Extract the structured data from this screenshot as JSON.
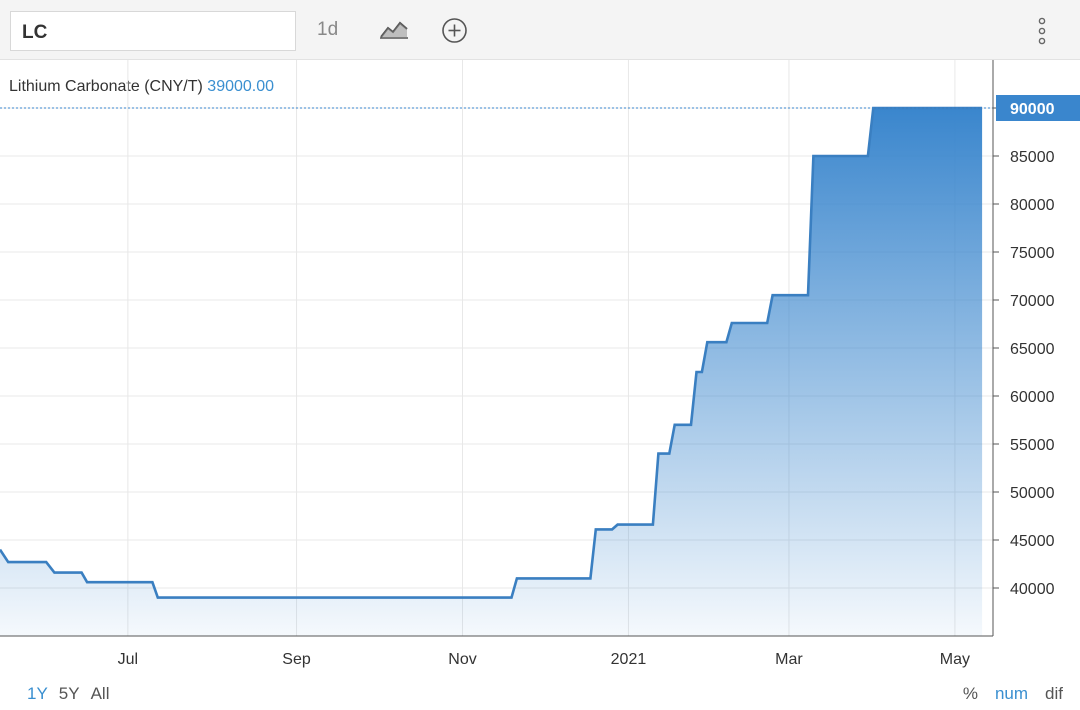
{
  "toolbar": {
    "symbol": "LC",
    "interval": "1d",
    "chart_type_icon": "line-chart-icon",
    "add_icon": "plus-circle-icon",
    "more_icon": "vertical-dots-icon"
  },
  "chart_title": {
    "name": "Lithium Carbonate (CNY/T)",
    "value": "39000.00"
  },
  "chart_data": {
    "type": "area",
    "title": "Lithium Carbonate (CNY/T)",
    "xlabel": "",
    "ylabel": "",
    "x_tick_labels": [
      "Jul",
      "Sep",
      "Nov",
      "2021",
      "Mar",
      "May"
    ],
    "y_tick_labels": [
      "40000",
      "45000",
      "50000",
      "55000",
      "60000",
      "65000",
      "70000",
      "75000",
      "80000",
      "85000",
      "90000"
    ],
    "ylim": [
      35000,
      95000
    ],
    "xlim": [
      "2020-05-15",
      "2021-05-15"
    ],
    "grid": true,
    "last_price_label": "90000",
    "colors": {
      "line": "#3a7fc1",
      "fill": "#3a86cd",
      "last_badge": "#3a86cd",
      "grid": "#e8e8e8"
    },
    "series": [
      {
        "x": [
          "2020-05-15",
          "2020-05-18",
          "2020-06-01",
          "2020-06-04",
          "2020-06-14",
          "2020-06-16",
          "2020-07-10",
          "2020-07-12",
          "2020-11-19",
          "2020-11-21",
          "2020-12-18",
          "2020-12-20",
          "2020-12-26",
          "2020-12-28",
          "2021-01-10",
          "2021-01-12",
          "2021-01-16",
          "2021-01-18",
          "2021-01-24",
          "2021-01-26",
          "2021-01-28",
          "2021-01-30",
          "2021-02-06",
          "2021-02-08",
          "2021-02-21",
          "2021-02-23",
          "2021-03-08",
          "2021-03-10",
          "2021-03-30",
          "2021-04-01",
          "2021-05-11"
        ],
        "y": [
          44000,
          42700,
          42700,
          41600,
          41600,
          40600,
          40600,
          39000,
          39000,
          41000,
          41000,
          46100,
          46100,
          46600,
          46600,
          54000,
          54000,
          57000,
          57000,
          62500,
          62500,
          65600,
          65600,
          67600,
          67600,
          70500,
          70500,
          85000,
          85000,
          90000,
          90000
        ]
      }
    ]
  },
  "footer": {
    "ranges": [
      "1Y",
      "5Y",
      "All"
    ],
    "active_range": "1Y",
    "modes": [
      "%",
      "num",
      "dif"
    ],
    "active_mode": "num"
  }
}
